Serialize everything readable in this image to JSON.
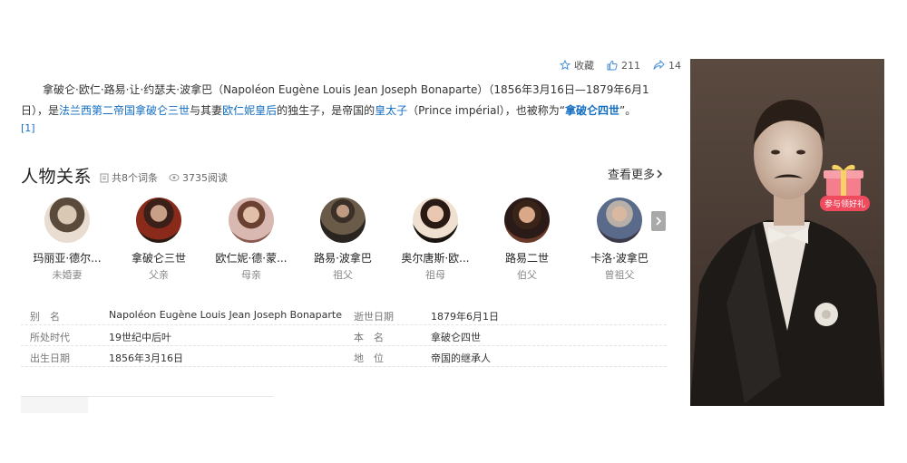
{
  "actions": {
    "favorite_label": "收藏",
    "like_count": "211",
    "share_count": "14"
  },
  "intro": {
    "line1": "拿破仑·欧仁·路易·让·约瑟夫·波拿巴（Napoléon Eugène Louis Jean Joseph Bonaparte）（1856年3月16日—1879年6月1",
    "line2_a": "日），是",
    "link_empire": "法兰西第二帝国",
    "link_napoleon3": "拿破仑三世",
    "line2_b": "与其妻",
    "link_eugenie": "欧仁妮皇后",
    "line2_c": "的独生子，是帝国的",
    "link_prince": "皇太子",
    "line2_d": "（Prince impérial），也被称为“",
    "link_napoleon4": "拿破仑四世",
    "line2_e": "”。",
    "ref": "[1]"
  },
  "relations": {
    "title": "人物关系",
    "entry_count": "共8个词条",
    "read_count": "3735阅读",
    "see_more": "查看更多",
    "people": [
      {
        "name": "玛丽亚·德尔...",
        "role": "未婚妻"
      },
      {
        "name": "拿破仑三世",
        "role": "父亲"
      },
      {
        "name": "欧仁妮·德·蒙...",
        "role": "母亲"
      },
      {
        "name": "路易·波拿巴",
        "role": "祖父"
      },
      {
        "name": "奥尔唐斯·欧...",
        "role": "祖母"
      },
      {
        "name": "路易二世",
        "role": "伯父"
      },
      {
        "name": "卡洛·波拿巴",
        "role": "曾祖父"
      }
    ]
  },
  "info": {
    "rows": [
      {
        "l1": "别　名",
        "v1": "Napoléon Eugène Louis Jean Joseph Bonaparte",
        "l2": "逝世日期",
        "v2": "1879年6月1日"
      },
      {
        "l1": "所处时代",
        "v1": "19世纪中后叶",
        "l2": "本　名",
        "v2": "拿破仑四世"
      },
      {
        "l1": "出生日期",
        "v1": "1856年3月16日",
        "l2": "地　位",
        "v2": "帝国的继承人"
      }
    ]
  },
  "gift": {
    "label": "参与领好礼"
  },
  "colors": {
    "link": "#136ec2",
    "gift": "#f04a5e"
  }
}
